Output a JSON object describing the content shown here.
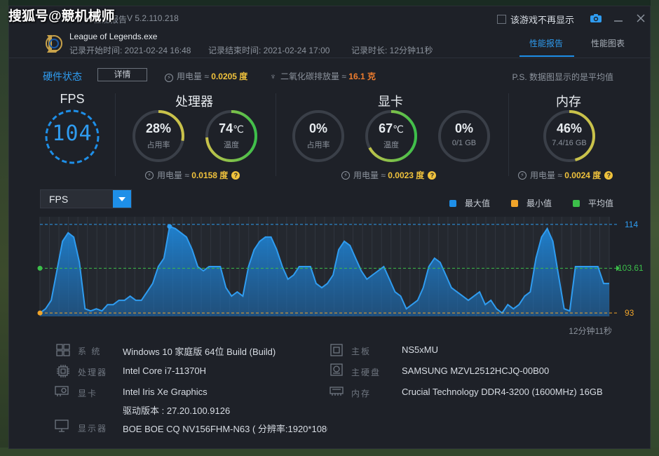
{
  "watermark": "搜狐号@競机械师",
  "titlebar": {
    "app_name": "性能报告",
    "version": "V 5.2.110.218",
    "hide_game_label": "该游戏不再显示"
  },
  "header": {
    "game_name": "League of Legends.exe",
    "start_label": "记录开始时间: 2021-02-24 16:48",
    "end_label": "记录结束时间: 2021-02-24 17:00",
    "duration_label": "记录时长: 12分钟11秒",
    "tabs": [
      "性能报告",
      "性能图表"
    ],
    "active_tab": 0
  },
  "hardware": {
    "title": "硬件状态",
    "detail_button": "详情",
    "power_label": "用电量 ≈",
    "power_value": "0.0205 度",
    "co2_label": "二氧化碳排放量 ≈",
    "co2_value": "16.1 克",
    "note": "P.S. 数据图显示的是平均值"
  },
  "sections": {
    "fps": {
      "title": "FPS",
      "value": "104"
    },
    "cpu": {
      "title": "处理器",
      "usage": {
        "value": "28%",
        "sub": "占用率",
        "fraction": 0.28
      },
      "temp": {
        "value": "74",
        "unit": "℃",
        "sub": "温度",
        "fraction": 0.74
      },
      "power_label": "用电量 ≈",
      "power_value": "0.0158 度"
    },
    "gpu": {
      "title": "显卡",
      "usage": {
        "value": "0%",
        "sub": "占用率",
        "fraction": 0
      },
      "temp": {
        "value": "67",
        "unit": "℃",
        "sub": "温度",
        "fraction": 0.67
      },
      "vram": {
        "value": "0%",
        "sub": "0/1 GB",
        "fraction": 0
      },
      "power_label": "用电量 ≈",
      "power_value": "0.0023 度"
    },
    "mem": {
      "title": "内存",
      "usage": {
        "value": "46%",
        "sub": "7.4/16 GB",
        "fraction": 0.46
      },
      "power_label": "用电量 ≈",
      "power_value": "0.0024 度"
    }
  },
  "chart_controls": {
    "metric": "FPS",
    "legend": [
      "最大值",
      "最小值",
      "平均值"
    ],
    "colors": {
      "max": "#1e8fe8",
      "min": "#f0a42a",
      "avg": "#3cbf4a"
    }
  },
  "chart_data": {
    "type": "area",
    "series": [
      {
        "name": "FPS",
        "values": [
          93,
          94,
          96,
          103,
          110,
          112,
          111,
          105,
          94,
          93.5,
          94,
          93.5,
          95,
          95,
          96,
          96,
          97,
          96,
          96,
          98,
          100,
          104,
          106,
          113.5,
          113,
          112,
          111,
          108,
          104,
          103,
          104,
          104,
          104,
          99,
          97,
          98,
          97,
          104,
          108,
          110,
          111,
          111,
          108,
          104,
          101,
          102,
          104,
          104,
          104,
          100,
          99,
          100,
          102,
          108,
          110,
          109,
          106,
          103,
          101,
          102,
          103,
          104,
          101,
          98,
          97,
          94,
          95,
          96,
          99,
          104,
          106,
          105,
          102,
          99,
          98,
          97,
          96,
          97,
          98,
          95,
          96,
          94,
          93,
          95,
          94,
          95,
          97,
          98,
          106,
          111,
          113,
          110,
          102,
          94,
          93.5,
          104,
          104,
          104,
          104,
          104,
          100,
          100
        ]
      }
    ],
    "max": 114,
    "avg": 103.61,
    "min": 93,
    "labels": {
      "max": "114",
      "avg": "103.61",
      "min": "93"
    },
    "duration": "12分钟11秒"
  },
  "specs": {
    "os_key": "系 统",
    "os_val": "Windows 10 家庭版 64位   Build (Build)",
    "cpu_key": "处理器",
    "cpu_val": "Intel Core i7-11370H",
    "gpu_key": "显卡",
    "gpu_val": "Intel Iris Xe Graphics",
    "driver_val": "驱动版本 : 27.20.100.9126",
    "monitor_key": "显示器",
    "monitor_val": "BOE BOE CQ NV156FHM-N63 ( 分辨率:1920*1080 (",
    "board_key": "主板",
    "board_val": "NS5xMU",
    "disk_key": "主硬盘",
    "disk_val": "SAMSUNG MZVL2512HCJQ-00B00",
    "ram_key": "内存",
    "ram_val": "Crucial Technology DDR4-3200 (1600MHz) 16GB"
  }
}
